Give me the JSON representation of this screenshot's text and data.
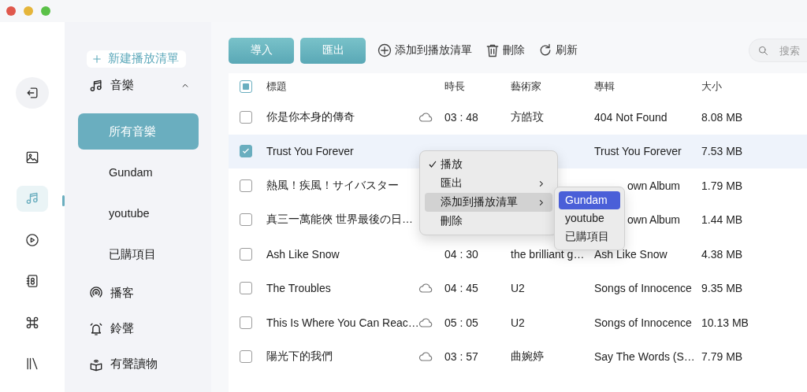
{
  "rail": [
    {
      "kind": "exit",
      "selected": false
    },
    {
      "kind": "photos",
      "selected": false
    },
    {
      "kind": "music",
      "selected": true
    },
    {
      "kind": "video",
      "selected": false
    },
    {
      "kind": "contacts",
      "selected": false
    },
    {
      "kind": "apps",
      "selected": false
    },
    {
      "kind": "library",
      "selected": false
    }
  ],
  "sidebar": {
    "new_playlist_button": "新建播放清單",
    "items": [
      {
        "kind": "music",
        "label": "音樂",
        "expanded": true,
        "children": [
          {
            "label": "所有音樂",
            "selected": true
          },
          {
            "label": "Gundam",
            "selected": false
          },
          {
            "label": "youtube",
            "selected": false
          },
          {
            "label": "已購項目",
            "selected": false
          }
        ]
      },
      {
        "kind": "podcast",
        "label": "播客"
      },
      {
        "kind": "ringtone",
        "label": "鈴聲"
      },
      {
        "kind": "audiobook",
        "label": "有聲讀物"
      }
    ]
  },
  "toolbar": {
    "buttons": [
      {
        "kind": "primary",
        "label": "導入"
      },
      {
        "kind": "primary",
        "label": "匯出"
      },
      {
        "kind": "add",
        "label": "添加到播放清單"
      },
      {
        "kind": "delete",
        "label": "刪除"
      },
      {
        "kind": "refresh",
        "label": "刷新"
      }
    ],
    "search": {
      "placeholder": "搜索"
    }
  },
  "table": {
    "select_all_partial": true,
    "columns": [
      "標題",
      "時長",
      "藝術家",
      "專輯",
      "大小"
    ],
    "rows": [
      {
        "checked": false,
        "selected": false,
        "cloud": true,
        "title": "你是你本身的傳奇",
        "duration": "03 : 48",
        "artist": "方皓玟",
        "album": "404 Not Found",
        "size": "8.08 MB"
      },
      {
        "checked": true,
        "selected": true,
        "cloud": false,
        "title": "Trust You Forever",
        "album": "Trust You Forever",
        "size": "7.53 MB"
      },
      {
        "checked": false,
        "selected": false,
        "cloud": false,
        "title": "熱風！疾風！サイバスター",
        "album": "own Album",
        "album_cut": true,
        "size": "1.79 MB"
      },
      {
        "checked": false,
        "selected": false,
        "cloud": false,
        "title": "真三一萬能俠 世界最後の日…",
        "album": "own Album",
        "album_cut": true,
        "size": "1.44 MB"
      },
      {
        "checked": false,
        "selected": false,
        "cloud": false,
        "title": "Ash Like Snow",
        "duration": "04 : 30",
        "artist": "the brilliant g…",
        "album": "Ash Like Snow",
        "size": "4.38 MB"
      },
      {
        "checked": false,
        "selected": false,
        "cloud": true,
        "title": "The Troubles",
        "duration": "04 : 45",
        "artist": "U2",
        "album": "Songs of Innocence",
        "size": "9.35 MB"
      },
      {
        "checked": false,
        "selected": false,
        "cloud": true,
        "title": "This Is Where You Can Reac…",
        "duration": "05 : 05",
        "artist": "U2",
        "album": "Songs of Innocence",
        "size": "10.13 MB"
      },
      {
        "checked": false,
        "selected": false,
        "cloud": true,
        "title": "陽光下的我們",
        "duration": "03 : 57",
        "artist": "曲婉婷",
        "album": "Say The Words (S…",
        "size": "7.79 MB"
      }
    ]
  },
  "context_menu": {
    "items": [
      {
        "label": "播放",
        "checked": true,
        "submenu": false,
        "highlighted": false
      },
      {
        "label": "匯出",
        "checked": false,
        "submenu": true,
        "highlighted": false
      },
      {
        "label": "添加到播放清單",
        "checked": false,
        "submenu": true,
        "highlighted": true
      },
      {
        "label": "刪除",
        "checked": false,
        "submenu": false,
        "highlighted": false
      }
    ],
    "submenu": [
      {
        "label": "Gundam",
        "selected": true
      },
      {
        "label": "youtube",
        "selected": false
      },
      {
        "label": "已購項目",
        "selected": false
      }
    ]
  }
}
